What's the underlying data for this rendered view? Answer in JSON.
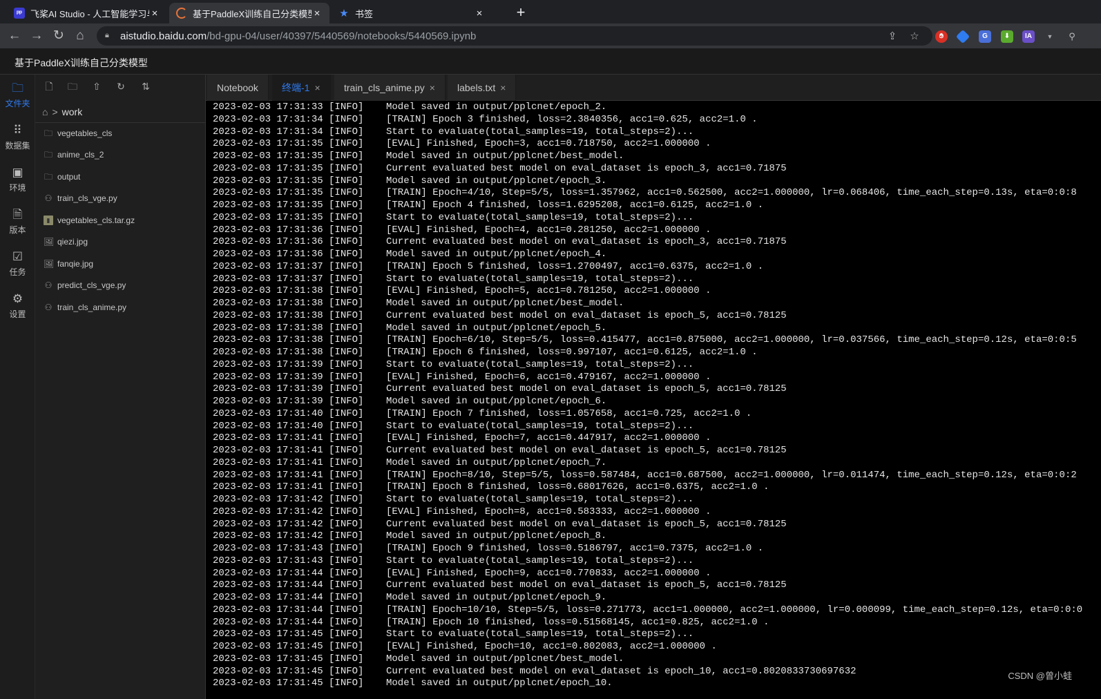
{
  "browser": {
    "tabs": [
      {
        "title": "飞桨AI Studio - 人工智能学习与",
        "favicon": "paddle-icon",
        "active": false
      },
      {
        "title": "基于PaddleX训练自己分类模型",
        "favicon": "loading-ring-icon",
        "active": true
      },
      {
        "title": "书签",
        "favicon": "star-icon",
        "active": false
      }
    ],
    "url_host": "aistudio.baidu.com",
    "url_path": "/bd-gpu-04/user/40397/5440569/notebooks/5440569.ipynb",
    "extensions": [
      "red-shield-ext-icon",
      "blue-diamond-ext-icon",
      "translate-ext-icon",
      "green-download-ext-icon",
      "ia-ext-icon"
    ],
    "ia_label": "IA"
  },
  "page": {
    "title": "基于PaddleX训练自己分类模型"
  },
  "activity_bar": [
    {
      "label": "文件夹",
      "icon": "folder-icon",
      "active": true
    },
    {
      "label": "数据集",
      "icon": "grid-dots-icon",
      "active": false
    },
    {
      "label": "环境",
      "icon": "blocks-icon",
      "active": false
    },
    {
      "label": "版本",
      "icon": "document-icon",
      "active": false
    },
    {
      "label": "任务",
      "icon": "task-icon",
      "active": false
    },
    {
      "label": "设置",
      "icon": "gear-icon",
      "active": false
    }
  ],
  "file_panel": {
    "breadcrumb": {
      "separator": ">",
      "current": "work"
    },
    "items": [
      {
        "name": "vegetables_cls",
        "type": "folder"
      },
      {
        "name": "anime_cls_2",
        "type": "folder"
      },
      {
        "name": "output",
        "type": "folder"
      },
      {
        "name": "train_cls_vge.py",
        "type": "python"
      },
      {
        "name": "vegetables_cls.tar.gz",
        "type": "archive"
      },
      {
        "name": "qiezi.jpg",
        "type": "image"
      },
      {
        "name": "fanqie.jpg",
        "type": "image"
      },
      {
        "name": "predict_cls_vge.py",
        "type": "python"
      },
      {
        "name": "train_cls_anime.py",
        "type": "python"
      }
    ]
  },
  "editor_tabs": [
    {
      "label": "Notebook",
      "closable": false,
      "active": false
    },
    {
      "label": "终端-1",
      "closable": true,
      "active": true
    },
    {
      "label": "train_cls_anime.py",
      "closable": true,
      "active": false
    },
    {
      "label": "labels.txt",
      "closable": true,
      "active": false
    }
  ],
  "close_glyph": "×",
  "terminal": {
    "lines": [
      {
        "ts": "2023-02-03 17:31:33 [INFO]",
        "msg": "Model saved in output/pplcnet/epoch_2."
      },
      {
        "ts": "2023-02-03 17:31:34 [INFO]",
        "msg": "[TRAIN] Epoch 3 finished, loss=2.3840356, acc1=0.625, acc2=1.0 ."
      },
      {
        "ts": "2023-02-03 17:31:34 [INFO]",
        "msg": "Start to evaluate(total_samples=19, total_steps=2)..."
      },
      {
        "ts": "2023-02-03 17:31:35 [INFO]",
        "msg": "[EVAL] Finished, Epoch=3, acc1=0.718750, acc2=1.000000 ."
      },
      {
        "ts": "2023-02-03 17:31:35 [INFO]",
        "msg": "Model saved in output/pplcnet/best_model."
      },
      {
        "ts": "2023-02-03 17:31:35 [INFO]",
        "msg": "Current evaluated best model on eval_dataset is epoch_3, acc1=0.71875"
      },
      {
        "ts": "2023-02-03 17:31:35 [INFO]",
        "msg": "Model saved in output/pplcnet/epoch_3."
      },
      {
        "ts": "2023-02-03 17:31:35 [INFO]",
        "msg": "[TRAIN] Epoch=4/10, Step=5/5, loss=1.357962, acc1=0.562500, acc2=1.000000, lr=0.068406, time_each_step=0.13s, eta=0:0:8"
      },
      {
        "ts": "2023-02-03 17:31:35 [INFO]",
        "msg": "[TRAIN] Epoch 4 finished, loss=1.6295208, acc1=0.6125, acc2=1.0 ."
      },
      {
        "ts": "2023-02-03 17:31:35 [INFO]",
        "msg": "Start to evaluate(total_samples=19, total_steps=2)..."
      },
      {
        "ts": "2023-02-03 17:31:36 [INFO]",
        "msg": "[EVAL] Finished, Epoch=4, acc1=0.281250, acc2=1.000000 ."
      },
      {
        "ts": "2023-02-03 17:31:36 [INFO]",
        "msg": "Current evaluated best model on eval_dataset is epoch_3, acc1=0.71875"
      },
      {
        "ts": "2023-02-03 17:31:36 [INFO]",
        "msg": "Model saved in output/pplcnet/epoch_4."
      },
      {
        "ts": "2023-02-03 17:31:37 [INFO]",
        "msg": "[TRAIN] Epoch 5 finished, loss=1.2700497, acc1=0.6375, acc2=1.0 ."
      },
      {
        "ts": "2023-02-03 17:31:37 [INFO]",
        "msg": "Start to evaluate(total_samples=19, total_steps=2)..."
      },
      {
        "ts": "2023-02-03 17:31:38 [INFO]",
        "msg": "[EVAL] Finished, Epoch=5, acc1=0.781250, acc2=1.000000 ."
      },
      {
        "ts": "2023-02-03 17:31:38 [INFO]",
        "msg": "Model saved in output/pplcnet/best_model."
      },
      {
        "ts": "2023-02-03 17:31:38 [INFO]",
        "msg": "Current evaluated best model on eval_dataset is epoch_5, acc1=0.78125"
      },
      {
        "ts": "2023-02-03 17:31:38 [INFO]",
        "msg": "Model saved in output/pplcnet/epoch_5."
      },
      {
        "ts": "2023-02-03 17:31:38 [INFO]",
        "msg": "[TRAIN] Epoch=6/10, Step=5/5, loss=0.415477, acc1=0.875000, acc2=1.000000, lr=0.037566, time_each_step=0.12s, eta=0:0:5"
      },
      {
        "ts": "2023-02-03 17:31:38 [INFO]",
        "msg": "[TRAIN] Epoch 6 finished, loss=0.997107, acc1=0.6125, acc2=1.0 ."
      },
      {
        "ts": "2023-02-03 17:31:39 [INFO]",
        "msg": "Start to evaluate(total_samples=19, total_steps=2)..."
      },
      {
        "ts": "2023-02-03 17:31:39 [INFO]",
        "msg": "[EVAL] Finished, Epoch=6, acc1=0.479167, acc2=1.000000 ."
      },
      {
        "ts": "2023-02-03 17:31:39 [INFO]",
        "msg": "Current evaluated best model on eval_dataset is epoch_5, acc1=0.78125"
      },
      {
        "ts": "2023-02-03 17:31:39 [INFO]",
        "msg": "Model saved in output/pplcnet/epoch_6."
      },
      {
        "ts": "2023-02-03 17:31:40 [INFO]",
        "msg": "[TRAIN] Epoch 7 finished, loss=1.057658, acc1=0.725, acc2=1.0 ."
      },
      {
        "ts": "2023-02-03 17:31:40 [INFO]",
        "msg": "Start to evaluate(total_samples=19, total_steps=2)..."
      },
      {
        "ts": "2023-02-03 17:31:41 [INFO]",
        "msg": "[EVAL] Finished, Epoch=7, acc1=0.447917, acc2=1.000000 ."
      },
      {
        "ts": "2023-02-03 17:31:41 [INFO]",
        "msg": "Current evaluated best model on eval_dataset is epoch_5, acc1=0.78125"
      },
      {
        "ts": "2023-02-03 17:31:41 [INFO]",
        "msg": "Model saved in output/pplcnet/epoch_7."
      },
      {
        "ts": "2023-02-03 17:31:41 [INFO]",
        "msg": "[TRAIN] Epoch=8/10, Step=5/5, loss=0.587484, acc1=0.687500, acc2=1.000000, lr=0.011474, time_each_step=0.12s, eta=0:0:2"
      },
      {
        "ts": "2023-02-03 17:31:41 [INFO]",
        "msg": "[TRAIN] Epoch 8 finished, loss=0.68017626, acc1=0.6375, acc2=1.0 ."
      },
      {
        "ts": "2023-02-03 17:31:42 [INFO]",
        "msg": "Start to evaluate(total_samples=19, total_steps=2)..."
      },
      {
        "ts": "2023-02-03 17:31:42 [INFO]",
        "msg": "[EVAL] Finished, Epoch=8, acc1=0.583333, acc2=1.000000 ."
      },
      {
        "ts": "2023-02-03 17:31:42 [INFO]",
        "msg": "Current evaluated best model on eval_dataset is epoch_5, acc1=0.78125"
      },
      {
        "ts": "2023-02-03 17:31:42 [INFO]",
        "msg": "Model saved in output/pplcnet/epoch_8."
      },
      {
        "ts": "2023-02-03 17:31:43 [INFO]",
        "msg": "[TRAIN] Epoch 9 finished, loss=0.5186797, acc1=0.7375, acc2=1.0 ."
      },
      {
        "ts": "2023-02-03 17:31:43 [INFO]",
        "msg": "Start to evaluate(total_samples=19, total_steps=2)..."
      },
      {
        "ts": "2023-02-03 17:31:44 [INFO]",
        "msg": "[EVAL] Finished, Epoch=9, acc1=0.770833, acc2=1.000000 ."
      },
      {
        "ts": "2023-02-03 17:31:44 [INFO]",
        "msg": "Current evaluated best model on eval_dataset is epoch_5, acc1=0.78125"
      },
      {
        "ts": "2023-02-03 17:31:44 [INFO]",
        "msg": "Model saved in output/pplcnet/epoch_9."
      },
      {
        "ts": "2023-02-03 17:31:44 [INFO]",
        "msg": "[TRAIN] Epoch=10/10, Step=5/5, loss=0.271773, acc1=1.000000, acc2=1.000000, lr=0.000099, time_each_step=0.12s, eta=0:0:0"
      },
      {
        "ts": "2023-02-03 17:31:44 [INFO]",
        "msg": "[TRAIN] Epoch 10 finished, loss=0.51568145, acc1=0.825, acc2=1.0 ."
      },
      {
        "ts": "2023-02-03 17:31:45 [INFO]",
        "msg": "Start to evaluate(total_samples=19, total_steps=2)..."
      },
      {
        "ts": "2023-02-03 17:31:45 [INFO]",
        "msg": "[EVAL] Finished, Epoch=10, acc1=0.802083, acc2=1.000000 ."
      },
      {
        "ts": "2023-02-03 17:31:45 [INFO]",
        "msg": "Model saved in output/pplcnet/best_model."
      },
      {
        "ts": "2023-02-03 17:31:45 [INFO]",
        "msg": "Current evaluated best model on eval_dataset is epoch_10, acc1=0.8020833730697632"
      },
      {
        "ts": "2023-02-03 17:31:45 [INFO]",
        "msg": "Model saved in output/pplcnet/epoch_10."
      }
    ]
  },
  "watermark": "CSDN @曾小蛙",
  "colors": {
    "accent": "#2f7bf0",
    "terminal_bg": "#000000",
    "panel_bg": "#1f1f1f"
  }
}
